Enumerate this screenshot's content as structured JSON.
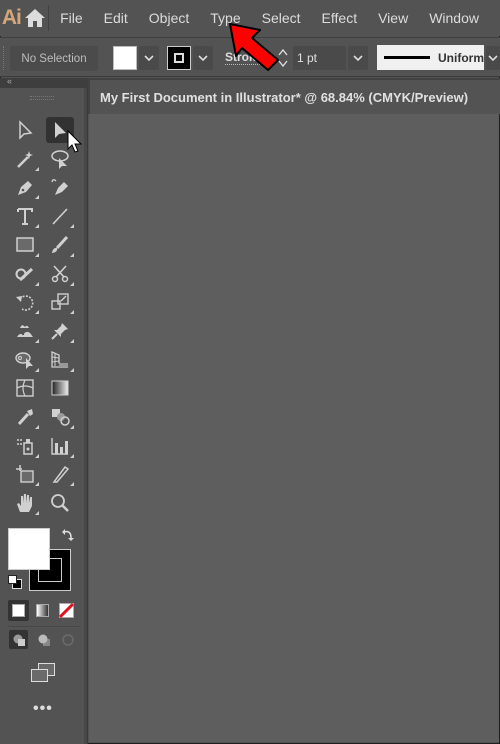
{
  "app": {
    "logo_text": "Ai",
    "brand_color": "#d3a77a"
  },
  "menubar": {
    "home_icon": "home-icon",
    "items": [
      {
        "label": "File"
      },
      {
        "label": "Edit"
      },
      {
        "label": "Object"
      },
      {
        "label": "Type"
      },
      {
        "label": "Select"
      },
      {
        "label": "Effect"
      },
      {
        "label": "View"
      },
      {
        "label": "Window"
      }
    ]
  },
  "controlbar": {
    "selection_status": "No Selection",
    "fill_color": "#ffffff",
    "stroke_color": "#000000",
    "stroke_label": "Stroke",
    "stroke_weight": "1 pt",
    "variable_width_profile": "Uniform"
  },
  "document": {
    "tab_title": "My First Document in Illustrator* @ 68.84% (CMYK/Preview)",
    "more_indicator": "»"
  },
  "toolbar": {
    "collapse_glyph": "«",
    "tools": [
      {
        "name": "direct-selection-tool",
        "icon": "direct-selection-icon",
        "active": false
      },
      {
        "name": "selection-tool",
        "icon": "selection-icon",
        "active": true
      },
      {
        "name": "magic-wand-tool",
        "icon": "magic-wand-icon",
        "active": false
      },
      {
        "name": "lasso-tool",
        "icon": "lasso-icon",
        "active": false
      },
      {
        "name": "pen-tool",
        "icon": "pen-icon",
        "active": false
      },
      {
        "name": "curvature-tool",
        "icon": "curvature-icon",
        "active": false
      },
      {
        "name": "type-tool",
        "icon": "type-icon",
        "active": false
      },
      {
        "name": "line-segment-tool",
        "icon": "line-icon",
        "active": false
      },
      {
        "name": "rectangle-tool",
        "icon": "rectangle-icon",
        "active": false
      },
      {
        "name": "paintbrush-tool",
        "icon": "paintbrush-icon",
        "active": false
      },
      {
        "name": "shaper-tool",
        "icon": "shaper-icon",
        "active": false
      },
      {
        "name": "scissors-tool",
        "icon": "scissors-icon",
        "active": false
      },
      {
        "name": "rotate-tool",
        "icon": "rotate-icon",
        "active": false
      },
      {
        "name": "scale-tool",
        "icon": "scale-icon",
        "active": false
      },
      {
        "name": "puppet-warp-tool",
        "icon": "puppet-warp-icon",
        "active": false
      },
      {
        "name": "pin-tool",
        "icon": "pin-icon",
        "active": false
      },
      {
        "name": "shape-builder-tool",
        "icon": "shape-builder-icon",
        "active": false
      },
      {
        "name": "perspective-grid-tool",
        "icon": "perspective-grid-icon",
        "active": false
      },
      {
        "name": "mesh-tool",
        "icon": "mesh-icon",
        "active": false
      },
      {
        "name": "gradient-tool",
        "icon": "gradient-icon",
        "active": false
      },
      {
        "name": "eyedropper-tool",
        "icon": "eyedropper-icon",
        "active": false
      },
      {
        "name": "blend-tool",
        "icon": "blend-icon",
        "active": false
      },
      {
        "name": "symbol-sprayer-tool",
        "icon": "symbol-sprayer-icon",
        "active": false
      },
      {
        "name": "column-graph-tool",
        "icon": "column-graph-icon",
        "active": false
      },
      {
        "name": "artboard-tool",
        "icon": "artboard-icon",
        "active": false
      },
      {
        "name": "slice-tool",
        "icon": "slice-icon",
        "active": false
      },
      {
        "name": "hand-tool",
        "icon": "hand-icon",
        "active": false
      },
      {
        "name": "zoom-tool",
        "icon": "zoom-icon",
        "active": false
      }
    ],
    "fill_color": "#ffffff",
    "stroke_color": "#000000",
    "color_modes": [
      "color",
      "gradient",
      "none"
    ],
    "draw_modes": [
      "draw-normal",
      "draw-behind",
      "draw-inside"
    ],
    "more_label": "•••"
  },
  "annotation": {
    "arrow_color": "#ff0000"
  }
}
